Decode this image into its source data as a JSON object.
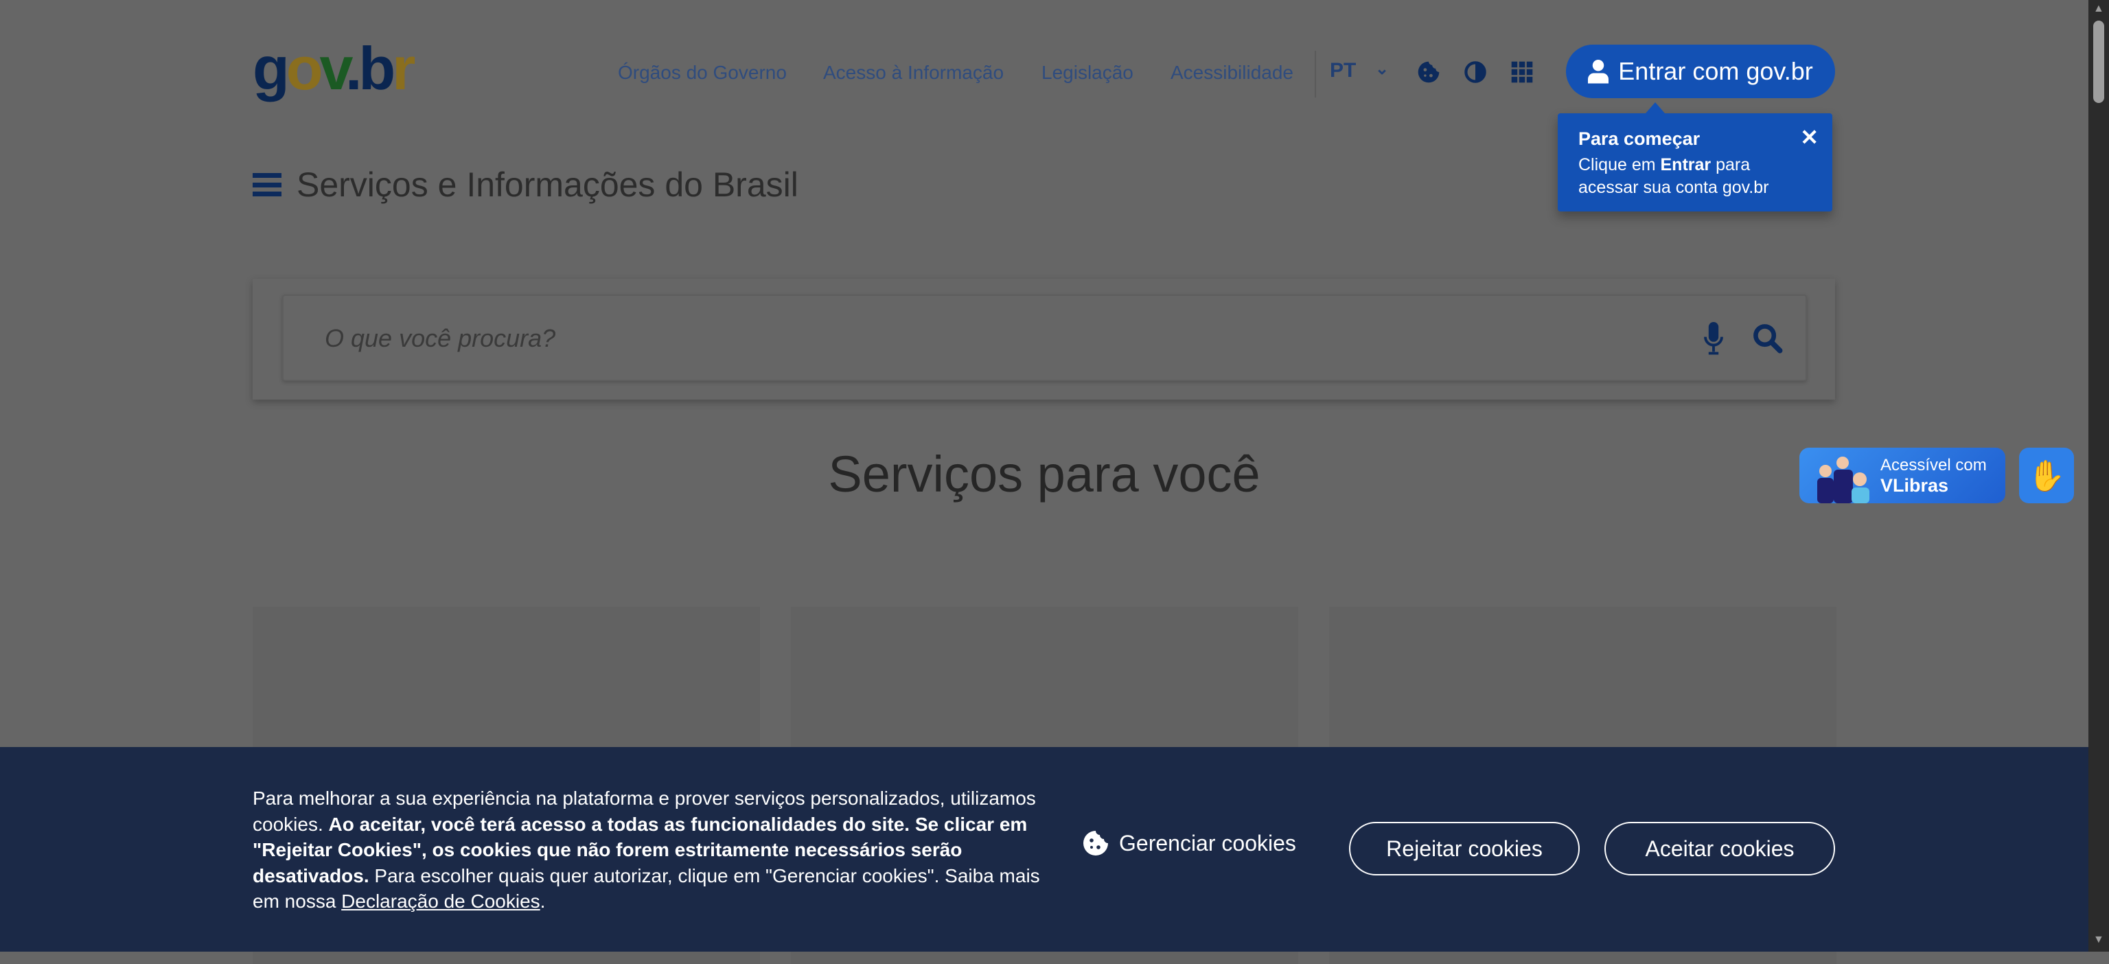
{
  "header": {
    "logo": "gov.br",
    "nav": [
      "Órgãos do Governo",
      "Acesso à Informação",
      "Legislação",
      "Acessibilidade"
    ],
    "language": "PT",
    "icons": [
      "cookie-icon",
      "contrast-icon",
      "apps-grid-icon"
    ],
    "login_label": "Entrar com gov.br"
  },
  "tooltip": {
    "title": "Para começar",
    "text_pre": "Clique em ",
    "text_bold": "Entrar",
    "text_post": " para acessar sua conta gov.br"
  },
  "menu": {
    "title": "Serviços e Informações do Brasil"
  },
  "search": {
    "placeholder": "O que você procura?"
  },
  "main": {
    "heading": "Serviços para você"
  },
  "vlibras": {
    "line1": "Acessível com",
    "line2": "VLibras"
  },
  "cookies": {
    "p1": "Para melhorar a sua experiência na plataforma e prover serviços personalizados, utilizamos cookies. ",
    "p2_bold": "Ao aceitar, você terá acesso a todas as funcionalidades do site. Se clicar em \"Rejeitar Cookies\", os cookies que não forem estritamente necessários serão desativados.",
    "p3": " Para escolher quais quer autorizar, clique em \"Gerenciar cookies\". Saiba mais em nossa ",
    "link": "Declaração de Cookies",
    "p4": ".",
    "manage": "Gerenciar cookies",
    "reject": "Rejeitar cookies",
    "accept": "Aceitar cookies"
  },
  "colors": {
    "primary": "#1351b4",
    "cookie_bar": "#1b2947",
    "overlay": "rgba(0,0,0,0.6)"
  }
}
